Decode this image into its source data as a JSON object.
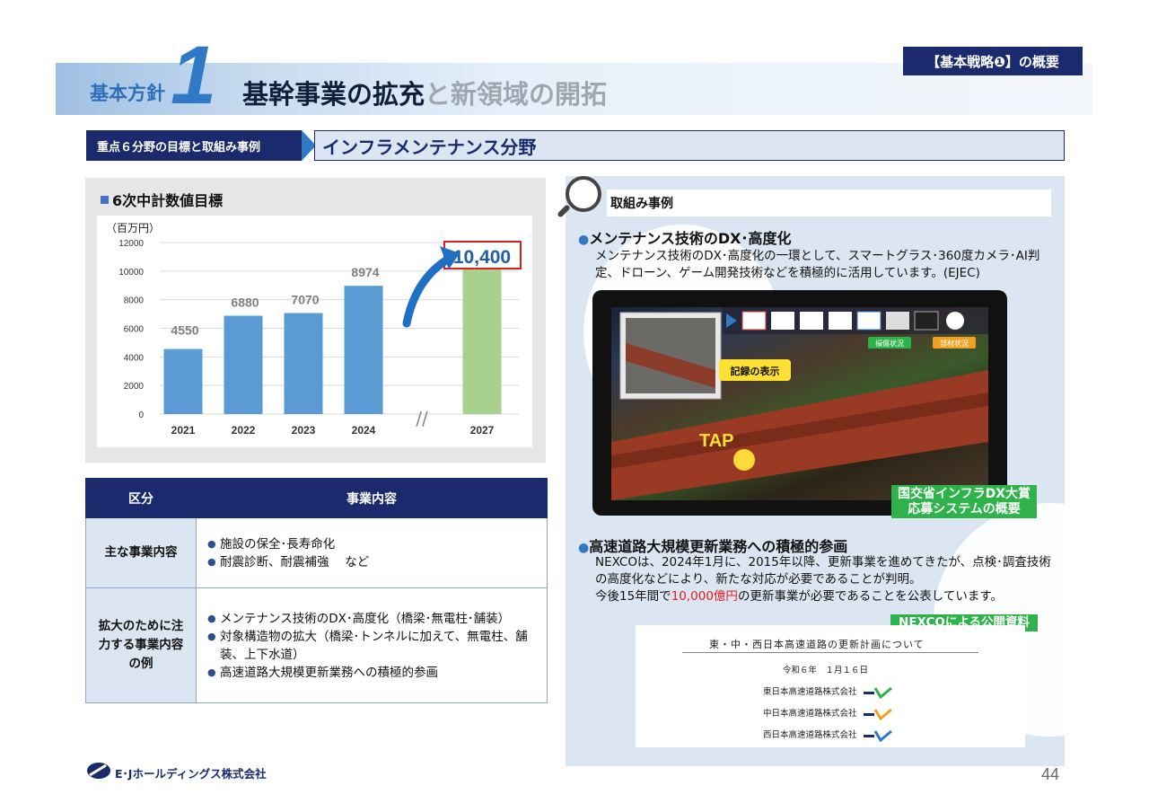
{
  "header": {
    "policy_label": "基本方針",
    "policy_number": "1",
    "title_main": "基幹事業の拡充",
    "title_sub": "と新領域の開拓",
    "strategy_tag": "【基本戦略❶】の概要"
  },
  "section": {
    "left_label": "重点６分野の目標と取組み事例",
    "right_label": "インフラメンテナンス分野"
  },
  "chart_section_title": "6次中計数値目標",
  "chart_data": {
    "type": "bar",
    "unit_label": "（百万円）",
    "categories": [
      "2021",
      "2022",
      "2023",
      "2024",
      "2027"
    ],
    "values": [
      4550,
      6880,
      7070,
      8974,
      10400
    ],
    "value_labels": [
      "4550",
      "6880",
      "7070",
      "8974",
      "10,400"
    ],
    "bar_colors": [
      "#5b9bd5",
      "#5b9bd5",
      "#5b9bd5",
      "#5b9bd5",
      "#a9d18e"
    ],
    "ylim": [
      0,
      12000
    ],
    "yticks": [
      "0",
      "2000",
      "4000",
      "6000",
      "8000",
      "10000",
      "12000"
    ],
    "axis_break": "//",
    "grid": true
  },
  "table": {
    "headers": [
      "区分",
      "事業内容"
    ],
    "rows": [
      {
        "key": "主な事業内容",
        "items": [
          "施設の保全･長寿命化",
          "耐震診断、耐震補強　 など"
        ]
      },
      {
        "key": "拡大のために注力する事業内容の例",
        "items": [
          "メンテナンス技術のDX･高度化（橋梁･無電柱･舗装）",
          "対象構造物の拡大（橋梁･トンネルに加えて、無電柱、舗装、上下水道）",
          "高速道路大規模更新業務への積極的参画"
        ]
      }
    ]
  },
  "right": {
    "label": "取組み事例",
    "item1_heading": "メンテナンス技術のDX･高度化",
    "item1_text": "メンテナンス技術のDX･高度化の一環として、スマートグラス･360度カメラ･AI判定、ドローン、ゲーム開発技術などを積極的に活用しています。(EJEC)",
    "screen_callout": "記録の表示",
    "screen_tap": "TAP",
    "screen_badge1": "損傷状況",
    "screen_badge2": "部材状況",
    "screen_tag_line1": "国交省インフラDX大賞",
    "screen_tag_line2": "応募システムの概要",
    "item2_heading": "高速道路大規模更新業務への積極的参画",
    "item2_text_a": "NEXCOは、2024年1月に、2015年以降、更新事業を進めてきたが、点検･調査技術の高度化などにより、新たな対応が必要であることが判明。",
    "item2_text_b": "今後15年間で",
    "item2_text_red": "10,000億円",
    "item2_text_c": "の更新事業が必要であることを公表しています。",
    "nexco_tag": "NEXCOによる公開資料",
    "doc_title": "東・中・西日本高速道路の更新計画について",
    "doc_date": "令和６年　１月１６日",
    "doc_companies": [
      "東日本高速道路株式会社",
      "中日本高速道路株式会社",
      "西日本高速道路株式会社"
    ]
  },
  "footer": {
    "company": "E･Jホールディングス株式会社",
    "page": "44"
  },
  "colors": {
    "navy": "#1a2a6c",
    "accent_blue": "#2f79c6",
    "bar_blue": "#5b9bd5",
    "bar_green": "#a9d18e",
    "highlight_red": "#e51a1a",
    "tag_green": "#2db34a"
  }
}
